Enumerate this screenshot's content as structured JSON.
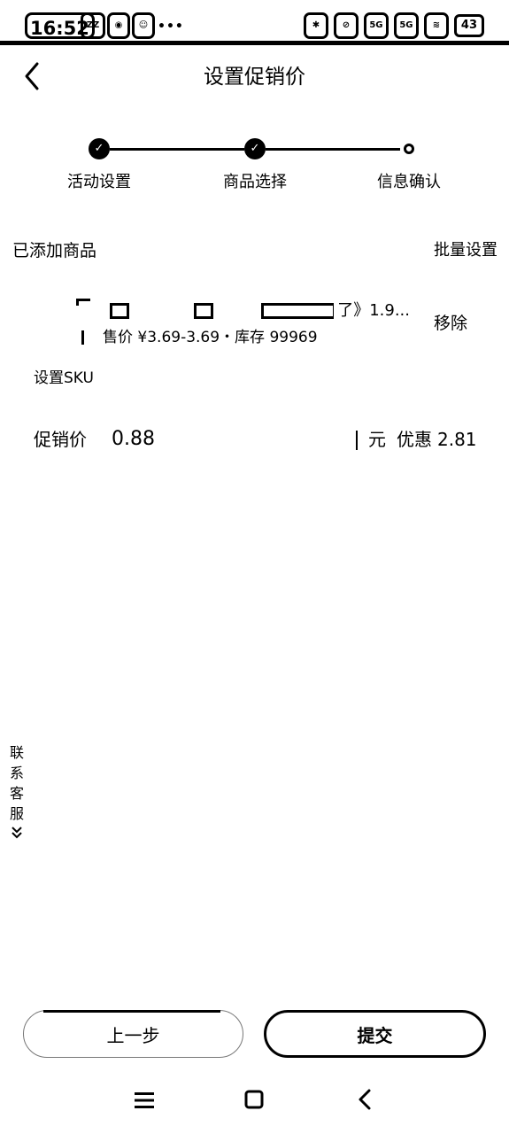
{
  "status_bar": {
    "time": "16:52",
    "chip_1": "ZZ",
    "net_1": "5G",
    "net_2": "5G",
    "battery": "43"
  },
  "header": {
    "title": "设置促销价",
    "back_icon": "chevron-left-icon"
  },
  "stepper": {
    "steps": [
      {
        "label": "活动设置",
        "state": "done"
      },
      {
        "label": "商品选择",
        "state": "done"
      },
      {
        "label": "信息确认",
        "state": "current"
      }
    ]
  },
  "section": {
    "title": "已添加商品",
    "batch_action": "批量设置"
  },
  "product": {
    "name_visible_tail": "了》1.9...",
    "meta": "售价 ¥3.69-3.69・库存 99969",
    "remove_label": "移除",
    "sku_link": "设置SKU"
  },
  "promo": {
    "label": "促销价",
    "value": "0.88",
    "unit": "元",
    "discount_label": "优惠",
    "discount_value": "2.81"
  },
  "contact": {
    "chars": [
      "联",
      "系",
      "客",
      "服"
    ],
    "chevron": "»"
  },
  "buttons": {
    "prev": "上一步",
    "submit": "提交"
  },
  "nav": {
    "menu_icon": "menu-icon",
    "home_icon": "home-square-icon",
    "back_icon": "back-chevron-icon"
  },
  "colors": {
    "text": "#000000",
    "background": "#ffffff"
  }
}
